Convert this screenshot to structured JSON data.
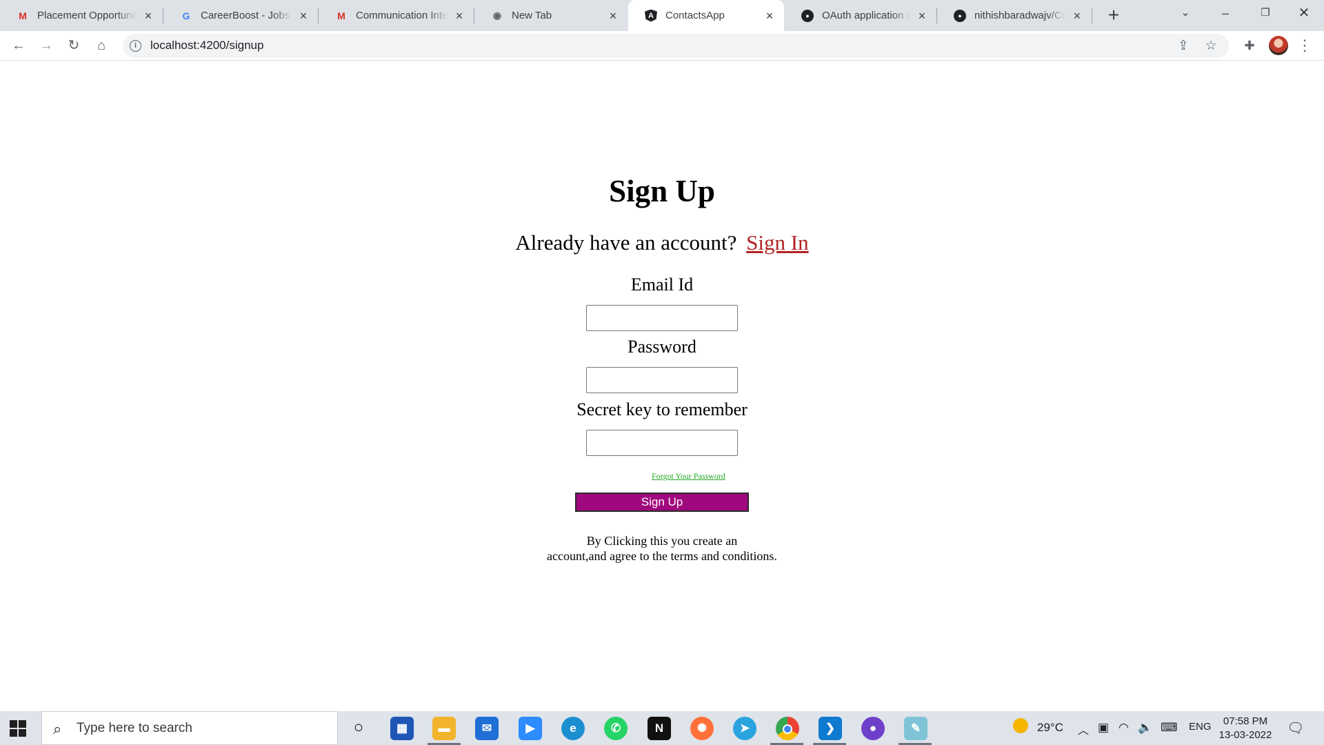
{
  "browser": {
    "tabs": [
      {
        "label": "Placement Opportunities",
        "icon": "gmail-icon",
        "icon_glyph": "M",
        "icon_color": "#d93025"
      },
      {
        "label": "CareerBoost - Jobs for",
        "icon": "google-icon",
        "icon_glyph": "G",
        "icon_color": "#4285f4"
      },
      {
        "label": "Communication Interv",
        "icon": "gmail-icon",
        "icon_glyph": "M",
        "icon_color": "#d93025"
      },
      {
        "label": "New Tab",
        "icon": "chrome-icon",
        "icon_glyph": "◉",
        "icon_color": "#5f6368"
      },
      {
        "label": "ContactsApp",
        "icon": "angular-icon",
        "icon_glyph": "A",
        "icon_color": "#202124"
      },
      {
        "label": "OAuth application au",
        "icon": "github-icon",
        "icon_glyph": "●",
        "icon_color": "#202124"
      },
      {
        "label": "nithishbaradwajv/Con",
        "icon": "github-icon",
        "icon_glyph": "●",
        "icon_color": "#202124"
      }
    ],
    "active_tab": 4,
    "url": "localhost:4200/signup"
  },
  "page": {
    "title": "Sign Up",
    "already_text": "Already have an account?",
    "signin_link": " Sign In",
    "email_label": "Email Id",
    "password_label": "Password",
    "secret_label": "Secret key to remember",
    "email_value": "",
    "password_value": "",
    "secret_value": "",
    "forgot_link": "Forgot Your Password",
    "submit_label": "Sign Up",
    "terms_line1": "By Clicking this you create an",
    "terms_line2": "account,and agree to the terms and conditions."
  },
  "colors": {
    "signin_link": "#b22222",
    "forgot_link": "#22a722",
    "submit_bg": "#a0087e"
  },
  "taskbar": {
    "search_placeholder": "Type here to search",
    "weather": "29°C",
    "language": "ENG",
    "time": "07:58 PM",
    "date": "13-03-2022"
  }
}
